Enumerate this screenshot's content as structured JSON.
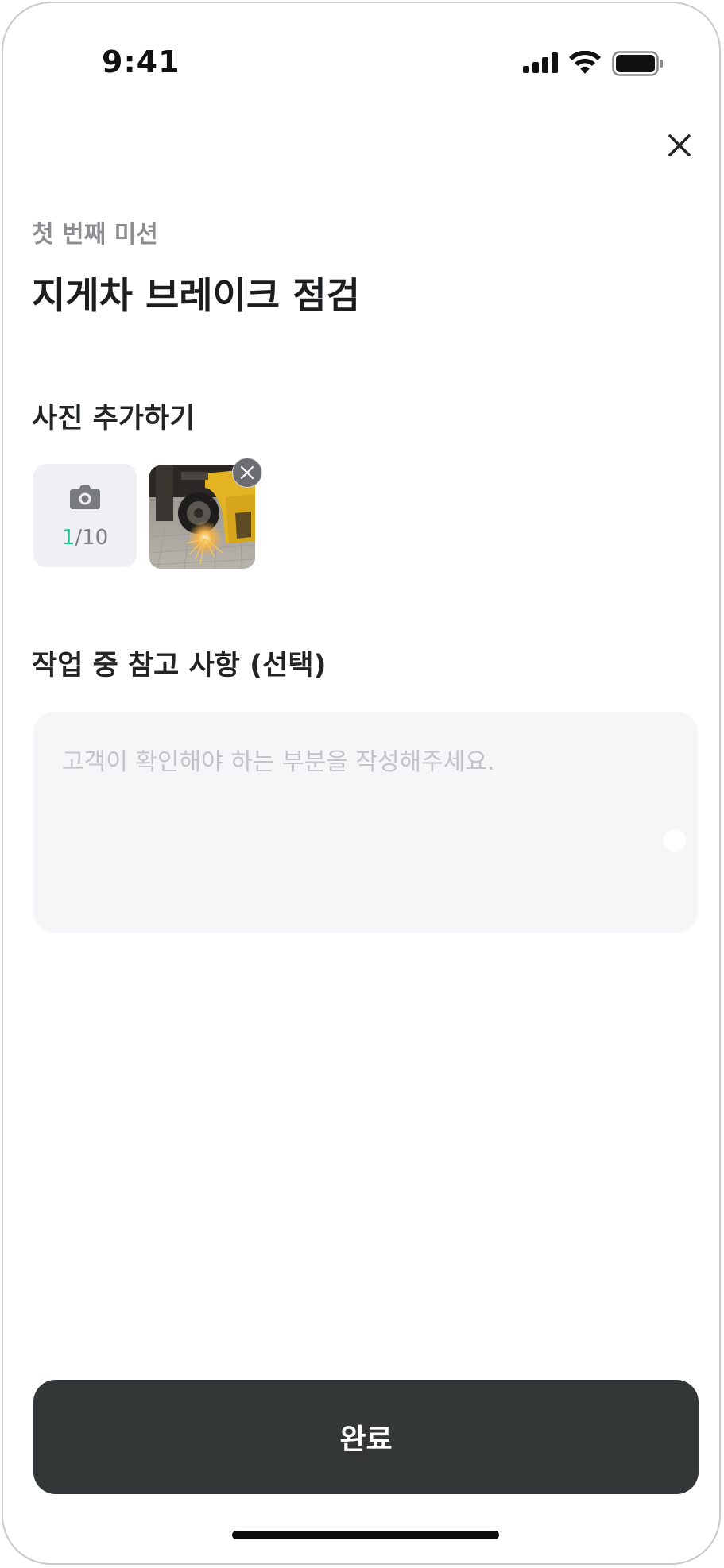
{
  "status_bar": {
    "time": "9:41",
    "icons": [
      "signal-icon",
      "wifi-icon",
      "battery-icon"
    ]
  },
  "header": {
    "close_icon": "close-icon"
  },
  "mission": {
    "label": "첫 번째 미션",
    "title": "지게차 브레이크 점검"
  },
  "photos": {
    "section_title": "사진 추가하기",
    "count_current": "1",
    "count_total": "/10",
    "add_icon": "camera-icon",
    "items": [
      {
        "name": "forklift-brake-photo",
        "remove_icon": "close-icon"
      }
    ]
  },
  "note": {
    "section_title": "작업 중 참고 사항 (선택)",
    "placeholder": "고객이 확인해야 하는 부분을 작성해주세요.",
    "value": ""
  },
  "footer": {
    "complete_label": "완료"
  },
  "colors": {
    "accent_green": "#1fc58e",
    "button_dark": "#343738",
    "field_bg": "#f6f6f8",
    "muted_text": "#8b8d91"
  }
}
